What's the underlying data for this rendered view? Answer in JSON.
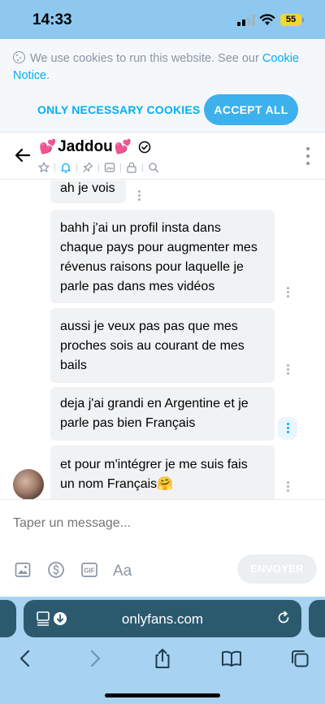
{
  "status_bar": {
    "time": "14:33",
    "battery": "55"
  },
  "cookie_banner": {
    "message": "We use cookies to run this website. See our",
    "link_text": "Cookie Notice",
    "suffix": ".",
    "btn_necessary": "ONLY NECESSARY COOKIES",
    "btn_accept": "ACCEPT ALL"
  },
  "chat": {
    "name": "Jaddou",
    "name_emoji": "💕",
    "header_icons": [
      "star-icon",
      "bell-icon",
      "pin-icon",
      "media-icon",
      "lock-icon",
      "search-icon"
    ]
  },
  "messages": [
    {
      "text": "ah je vois"
    },
    {
      "text": "bahh j'ai un profil insta dans chaque pays pour augmenter mes révenus raisons pour laquelle je parle pas dans mes vidéos"
    },
    {
      "text": "aussi je veux pas pas que mes proches sois au courant de mes bails"
    },
    {
      "text": "deja j'ai grandi en Argentine et je parle pas bien Français"
    },
    {
      "text": "et pour m'intégrer je me suis fais un nom Français🤗"
    }
  ],
  "composer": {
    "placeholder": "Taper un message...",
    "send_label": "ENVOYER",
    "tools": [
      "image-icon",
      "dollar-icon",
      "gif-icon",
      "text-format-icon"
    ]
  },
  "browser": {
    "url": "onlyfans.com"
  },
  "colors": {
    "accent": "#00aff0",
    "status_bar": "#8ec8ee",
    "url_bar": "#2b5a6e",
    "bubble": "#f0f2f4"
  }
}
